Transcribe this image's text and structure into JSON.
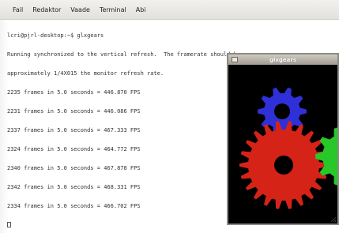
{
  "terminal": {
    "menu": [
      "Fail",
      "Redaktor",
      "Vaade",
      "Terminal",
      "Abi"
    ],
    "lines": [
      "lcri@pjrl-desktop:~$ glxgears",
      "Running synchronized to the vertical refresh.  The framerate should be",
      "approximately 1/4X015 the monitor refresh rate.",
      "2235 frames in 5.0 seconds = 446.870 FPS",
      "2231 frames in 5.0 seconds = 446.086 FPS",
      "2337 frames in 5.0 seconds = 467.333 FPS",
      "2324 frames in 5.0 seconds = 464.772 FPS",
      "2340 frames in 5.0 seconds = 467.878 FPS",
      "2342 frames in 5.0 seconds = 468.331 FPS",
      "2334 frames in 5.0 seconds = 466.702 FPS"
    ]
  },
  "glxgears_window": {
    "title": "glxgears",
    "gears": [
      {
        "name": "blue gear",
        "color": "#3030d8"
      },
      {
        "name": "red gear",
        "color": "#d52318"
      },
      {
        "name": "green gear",
        "color": "#28c828"
      }
    ]
  },
  "colors": {
    "terminal_bg": "#ffffff",
    "text": "#333333",
    "menubar": "#e9e7e3",
    "gears_bg": "#000000"
  }
}
